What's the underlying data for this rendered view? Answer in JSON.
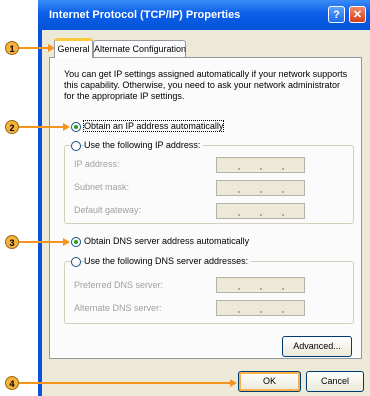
{
  "window": {
    "title": "Internet Protocol (TCP/IP) Properties",
    "help_label": "?",
    "close_label": "✕"
  },
  "tabs": [
    {
      "label": "General",
      "selected": true
    },
    {
      "label": "Alternate Configuration",
      "selected": false
    }
  ],
  "description": "You can get IP settings assigned automatically if your network supports this capability. Otherwise, you need to ask your network administrator for the appropriate IP settings.",
  "ip_options": {
    "auto": {
      "label": "Obtain an IP address automatically",
      "checked": true
    },
    "manual": {
      "label": "Use the following IP address:",
      "checked": false
    }
  },
  "ip_fields": [
    {
      "label": "IP address:",
      "value": ""
    },
    {
      "label": "Subnet mask:",
      "value": ""
    },
    {
      "label": "Default gateway:",
      "value": ""
    }
  ],
  "dns_options": {
    "auto": {
      "label": "Obtain DNS server address automatically",
      "checked": true
    },
    "manual": {
      "label": "Use the following DNS server addresses:",
      "checked": false
    }
  },
  "dns_fields": [
    {
      "label": "Preferred DNS server:",
      "value": ""
    },
    {
      "label": "Alternate DNS server:",
      "value": ""
    }
  ],
  "buttons": {
    "advanced": "Advanced...",
    "ok": "OK",
    "cancel": "Cancel"
  },
  "callouts": [
    "1",
    "2",
    "3",
    "4"
  ],
  "colors": {
    "title_bar": "#0b5ee8",
    "dialog_face": "#ece9d8",
    "callout": "#f7b23e",
    "arrow": "#f5931f",
    "radio_check": "#21a121"
  }
}
